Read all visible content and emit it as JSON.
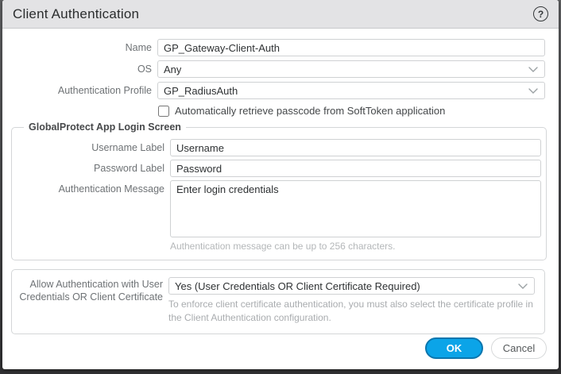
{
  "dialog": {
    "title": "Client Authentication",
    "help_icon_glyph": "?"
  },
  "fields": {
    "name": {
      "label": "Name",
      "value": "GP_Gateway-Client-Auth"
    },
    "os": {
      "label": "OS",
      "value": "Any"
    },
    "auth_profile": {
      "label": "Authentication Profile",
      "value": "GP_RadiusAuth"
    },
    "softtoken": {
      "label": "Automatically retrieve passcode from SoftToken application",
      "checked": false
    }
  },
  "login_screen_group": {
    "legend": "GlobalProtect App Login Screen",
    "username": {
      "label": "Username Label",
      "value": "Username"
    },
    "password": {
      "label": "Password Label",
      "value": "Password"
    },
    "auth_message": {
      "label": "Authentication Message",
      "value": "Enter login credentials",
      "hint": "Authentication message can be up to 256 characters."
    }
  },
  "cert_section": {
    "label": "Allow Authentication with User Credentials OR Client Certificate",
    "value": "Yes (User Credentials OR Client Certificate Required)",
    "hint": "To enforce client certificate authentication, you must also select the certificate profile in the Client Authentication configuration."
  },
  "footer": {
    "ok_label": "OK",
    "cancel_label": "Cancel"
  },
  "colors": {
    "accent_blue": "#0ba4e8",
    "accent_blue_border": "#0b76ae",
    "titlebar_bg": "#e3e3e5",
    "label_gray": "#6e7275",
    "hint_gray": "#b4b7b9",
    "border_gray": "#cfd1d3",
    "backdrop": "#3a3a3c"
  }
}
